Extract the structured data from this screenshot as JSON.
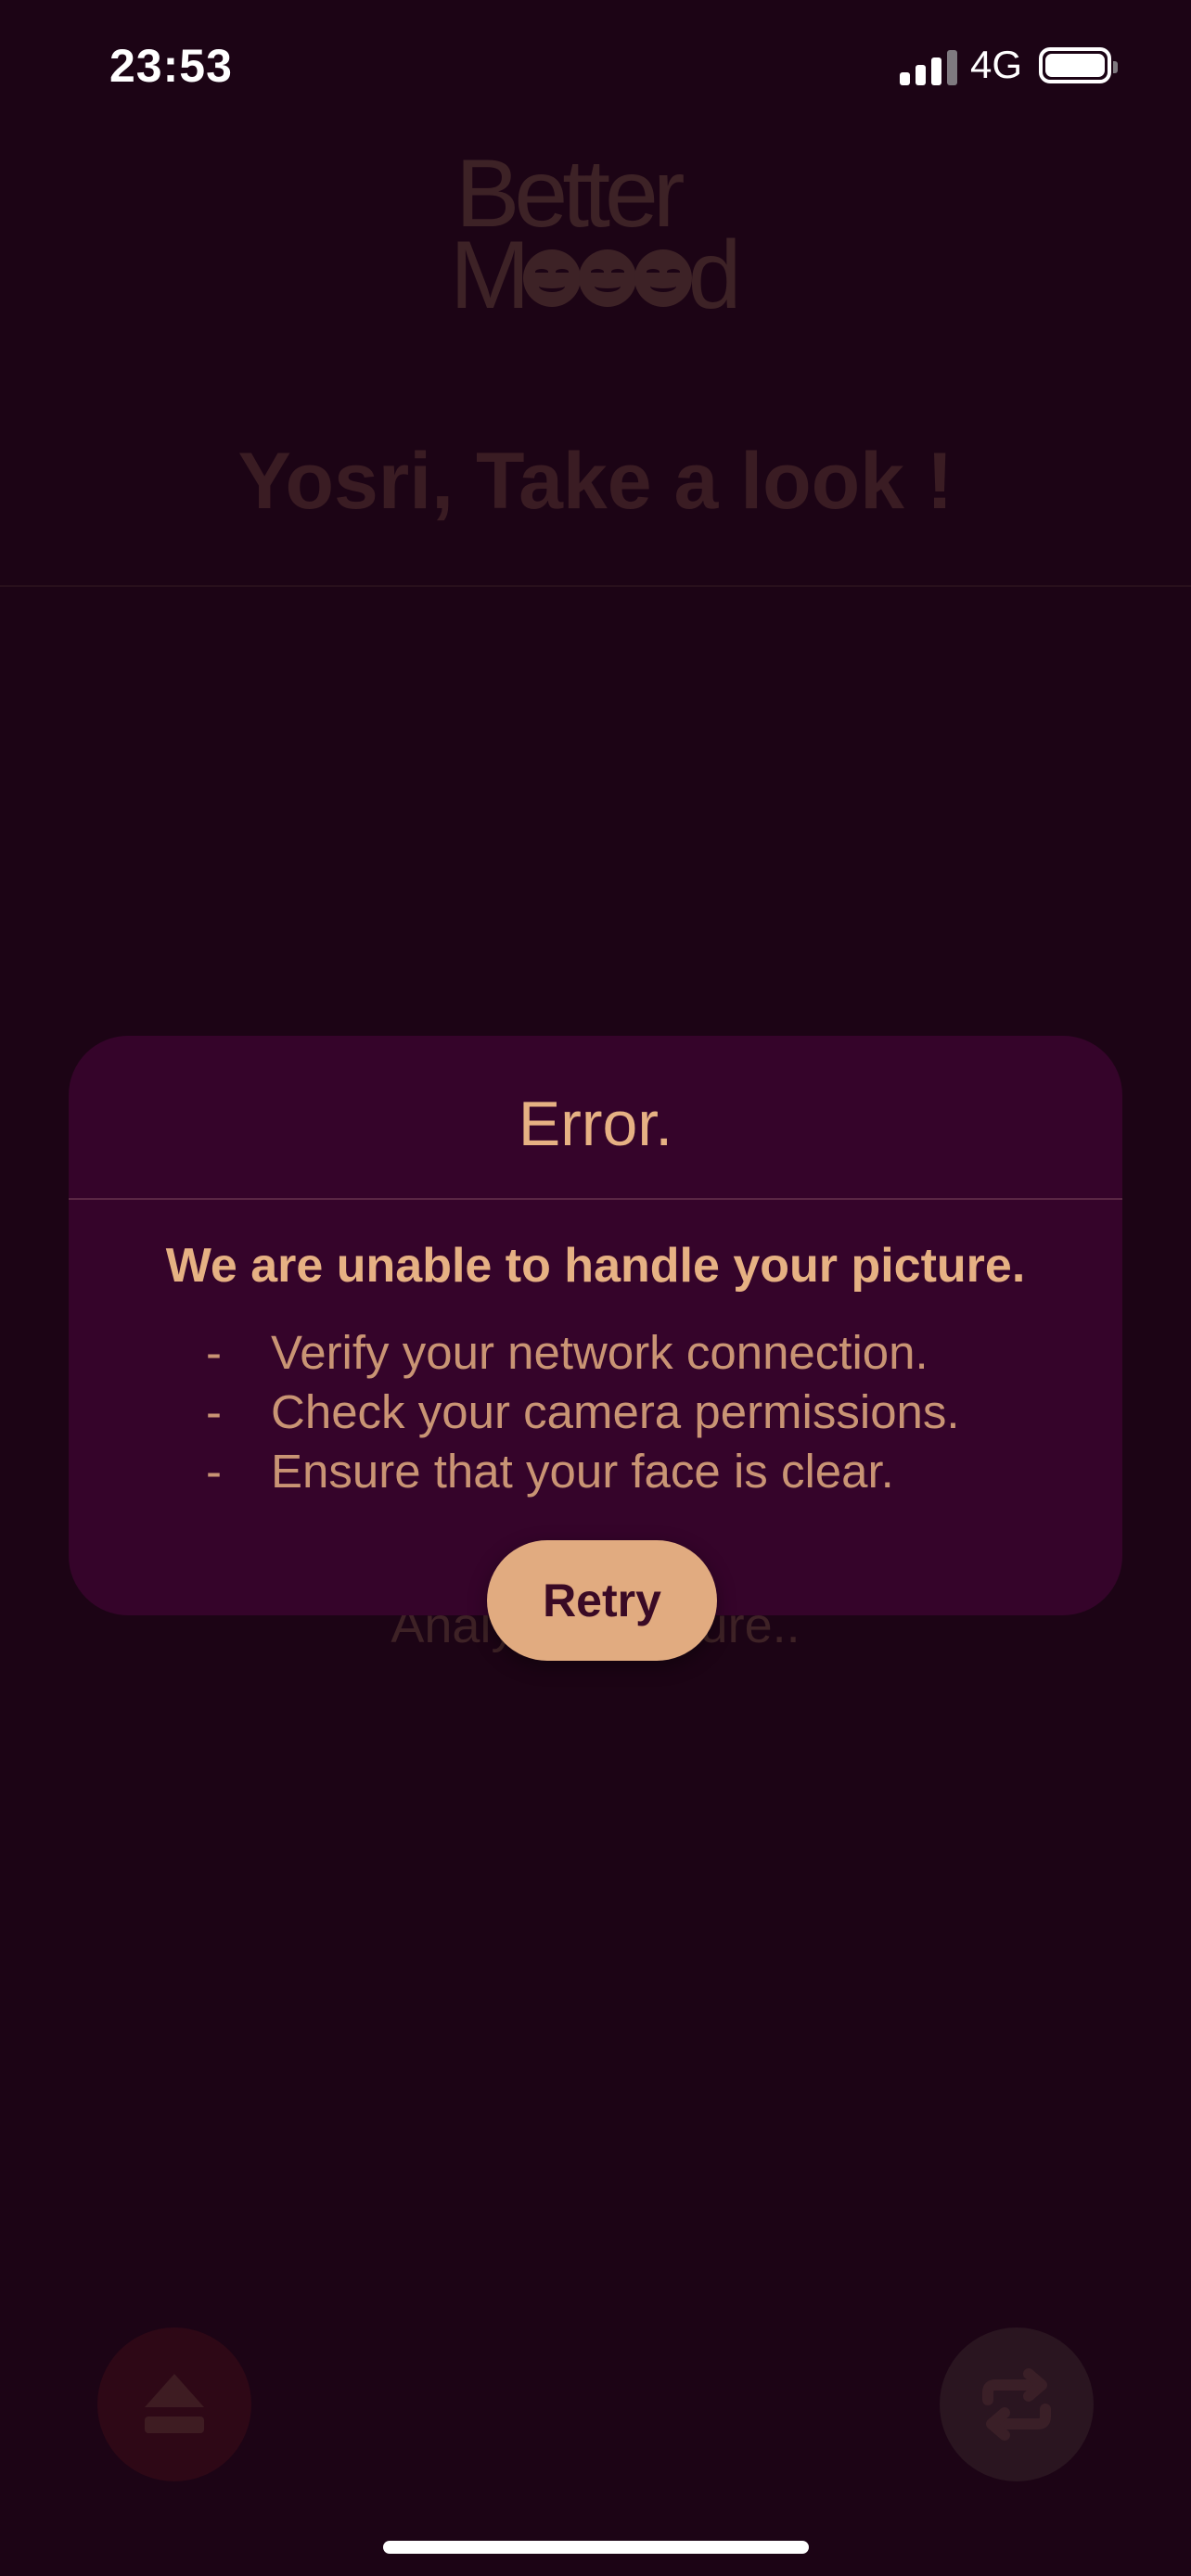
{
  "status_bar": {
    "time": "23:53",
    "network": "4G"
  },
  "logo": {
    "line1": "Better",
    "line2_start": "M",
    "line2_end": "d"
  },
  "header": {
    "title": "Yosri, Take a look !"
  },
  "background": {
    "status_text": "Analyzing picture.."
  },
  "dialog": {
    "title": "Error.",
    "message": "We are unable to handle your picture.",
    "items": [
      "Verify your network connection.",
      "Check your camera permissions.",
      "Ensure that your face is clear."
    ],
    "bullet": "-",
    "retry_label": "Retry"
  },
  "icons": {
    "bottom_left": "eject-icon",
    "bottom_right": "switch-camera-icon"
  },
  "colors": {
    "background": "#1c0415",
    "dialog": "#35042a",
    "accent": "#e1ab80",
    "text": "#e6b183"
  }
}
